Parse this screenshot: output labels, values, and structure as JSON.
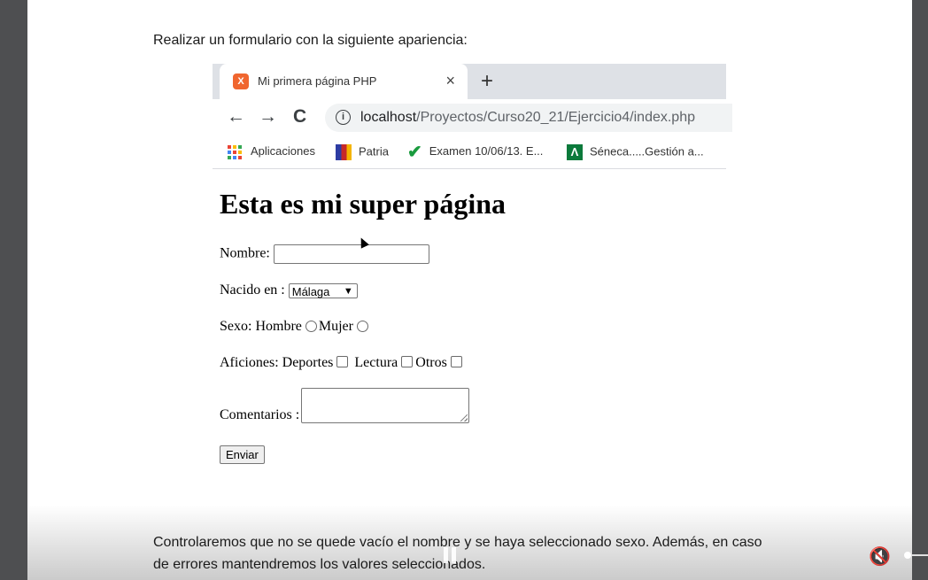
{
  "intro_text": "Realizar un formulario con la siguiente apariencia:",
  "browser": {
    "tab": {
      "title": "Mi primera página PHP",
      "close_label": "×",
      "new_tab_label": "+"
    },
    "nav": {
      "back": "←",
      "forward": "→",
      "reload": "C"
    },
    "url": {
      "host": "localhost",
      "path": "/Proyectos/Curso20_21/Ejercicio4/index.php"
    },
    "bookmarks": [
      {
        "label": "Aplicaciones",
        "icon": "apps-grid-icon"
      },
      {
        "label": "Patria",
        "icon": "book-icon"
      },
      {
        "label": "Examen 10/06/13. E...",
        "icon": "checkmark-icon"
      },
      {
        "label": "Séneca.....Gestión a...",
        "icon": "andalucia-logo-icon"
      }
    ]
  },
  "form": {
    "heading": "Esta es mi super página",
    "nombre_label": "Nombre:",
    "nacido_label": "Nacido en :",
    "nacido_value": "Málaga",
    "sexo_label": "Sexo: Hombre",
    "sexo_mujer": "Mujer",
    "aficiones_label": "Aficiones: Deportes",
    "lectura": "Lectura",
    "otros": "Otros",
    "comentarios_label": "Comentarios :",
    "submit": "Enviar"
  },
  "footer": {
    "line1": "Controlaremos que no se quede vacío el nombre y se haya seleccionado sexo. Además, en caso",
    "line2": "de errores mantendremos los valores seleccionados."
  },
  "colors": {
    "favicon": "#f0662f",
    "tabbar": "#dee1e6",
    "side_panel": "#4e4f51"
  }
}
